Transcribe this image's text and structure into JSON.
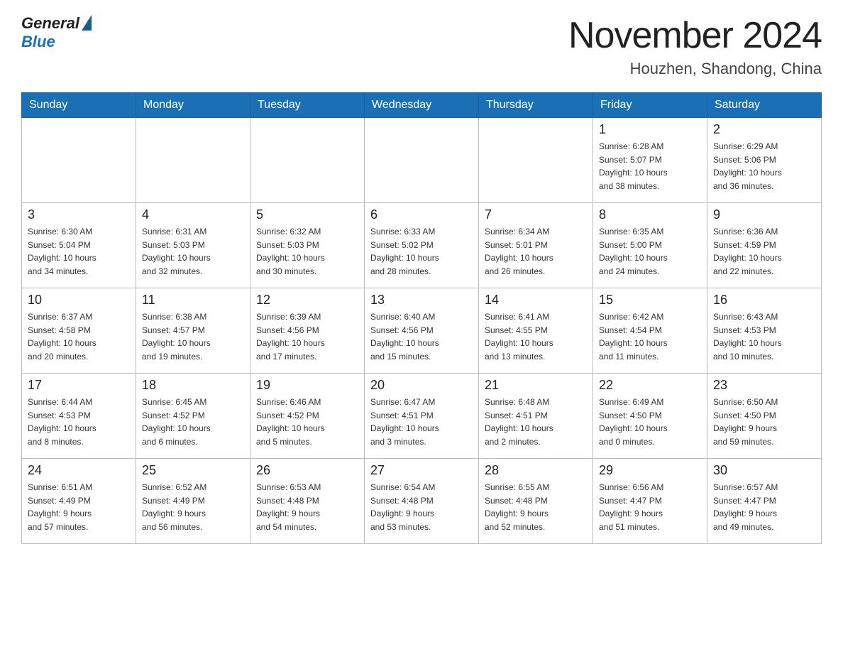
{
  "header": {
    "logo_general": "General",
    "logo_blue": "Blue",
    "title": "November 2024",
    "subtitle": "Houzhen, Shandong, China"
  },
  "weekdays": [
    "Sunday",
    "Monday",
    "Tuesday",
    "Wednesday",
    "Thursday",
    "Friday",
    "Saturday"
  ],
  "weeks": [
    [
      {
        "day": "",
        "info": ""
      },
      {
        "day": "",
        "info": ""
      },
      {
        "day": "",
        "info": ""
      },
      {
        "day": "",
        "info": ""
      },
      {
        "day": "",
        "info": ""
      },
      {
        "day": "1",
        "info": "Sunrise: 6:28 AM\nSunset: 5:07 PM\nDaylight: 10 hours\nand 38 minutes."
      },
      {
        "day": "2",
        "info": "Sunrise: 6:29 AM\nSunset: 5:06 PM\nDaylight: 10 hours\nand 36 minutes."
      }
    ],
    [
      {
        "day": "3",
        "info": "Sunrise: 6:30 AM\nSunset: 5:04 PM\nDaylight: 10 hours\nand 34 minutes."
      },
      {
        "day": "4",
        "info": "Sunrise: 6:31 AM\nSunset: 5:03 PM\nDaylight: 10 hours\nand 32 minutes."
      },
      {
        "day": "5",
        "info": "Sunrise: 6:32 AM\nSunset: 5:03 PM\nDaylight: 10 hours\nand 30 minutes."
      },
      {
        "day": "6",
        "info": "Sunrise: 6:33 AM\nSunset: 5:02 PM\nDaylight: 10 hours\nand 28 minutes."
      },
      {
        "day": "7",
        "info": "Sunrise: 6:34 AM\nSunset: 5:01 PM\nDaylight: 10 hours\nand 26 minutes."
      },
      {
        "day": "8",
        "info": "Sunrise: 6:35 AM\nSunset: 5:00 PM\nDaylight: 10 hours\nand 24 minutes."
      },
      {
        "day": "9",
        "info": "Sunrise: 6:36 AM\nSunset: 4:59 PM\nDaylight: 10 hours\nand 22 minutes."
      }
    ],
    [
      {
        "day": "10",
        "info": "Sunrise: 6:37 AM\nSunset: 4:58 PM\nDaylight: 10 hours\nand 20 minutes."
      },
      {
        "day": "11",
        "info": "Sunrise: 6:38 AM\nSunset: 4:57 PM\nDaylight: 10 hours\nand 19 minutes."
      },
      {
        "day": "12",
        "info": "Sunrise: 6:39 AM\nSunset: 4:56 PM\nDaylight: 10 hours\nand 17 minutes."
      },
      {
        "day": "13",
        "info": "Sunrise: 6:40 AM\nSunset: 4:56 PM\nDaylight: 10 hours\nand 15 minutes."
      },
      {
        "day": "14",
        "info": "Sunrise: 6:41 AM\nSunset: 4:55 PM\nDaylight: 10 hours\nand 13 minutes."
      },
      {
        "day": "15",
        "info": "Sunrise: 6:42 AM\nSunset: 4:54 PM\nDaylight: 10 hours\nand 11 minutes."
      },
      {
        "day": "16",
        "info": "Sunrise: 6:43 AM\nSunset: 4:53 PM\nDaylight: 10 hours\nand 10 minutes."
      }
    ],
    [
      {
        "day": "17",
        "info": "Sunrise: 6:44 AM\nSunset: 4:53 PM\nDaylight: 10 hours\nand 8 minutes."
      },
      {
        "day": "18",
        "info": "Sunrise: 6:45 AM\nSunset: 4:52 PM\nDaylight: 10 hours\nand 6 minutes."
      },
      {
        "day": "19",
        "info": "Sunrise: 6:46 AM\nSunset: 4:52 PM\nDaylight: 10 hours\nand 5 minutes."
      },
      {
        "day": "20",
        "info": "Sunrise: 6:47 AM\nSunset: 4:51 PM\nDaylight: 10 hours\nand 3 minutes."
      },
      {
        "day": "21",
        "info": "Sunrise: 6:48 AM\nSunset: 4:51 PM\nDaylight: 10 hours\nand 2 minutes."
      },
      {
        "day": "22",
        "info": "Sunrise: 6:49 AM\nSunset: 4:50 PM\nDaylight: 10 hours\nand 0 minutes."
      },
      {
        "day": "23",
        "info": "Sunrise: 6:50 AM\nSunset: 4:50 PM\nDaylight: 9 hours\nand 59 minutes."
      }
    ],
    [
      {
        "day": "24",
        "info": "Sunrise: 6:51 AM\nSunset: 4:49 PM\nDaylight: 9 hours\nand 57 minutes."
      },
      {
        "day": "25",
        "info": "Sunrise: 6:52 AM\nSunset: 4:49 PM\nDaylight: 9 hours\nand 56 minutes."
      },
      {
        "day": "26",
        "info": "Sunrise: 6:53 AM\nSunset: 4:48 PM\nDaylight: 9 hours\nand 54 minutes."
      },
      {
        "day": "27",
        "info": "Sunrise: 6:54 AM\nSunset: 4:48 PM\nDaylight: 9 hours\nand 53 minutes."
      },
      {
        "day": "28",
        "info": "Sunrise: 6:55 AM\nSunset: 4:48 PM\nDaylight: 9 hours\nand 52 minutes."
      },
      {
        "day": "29",
        "info": "Sunrise: 6:56 AM\nSunset: 4:47 PM\nDaylight: 9 hours\nand 51 minutes."
      },
      {
        "day": "30",
        "info": "Sunrise: 6:57 AM\nSunset: 4:47 PM\nDaylight: 9 hours\nand 49 minutes."
      }
    ]
  ]
}
